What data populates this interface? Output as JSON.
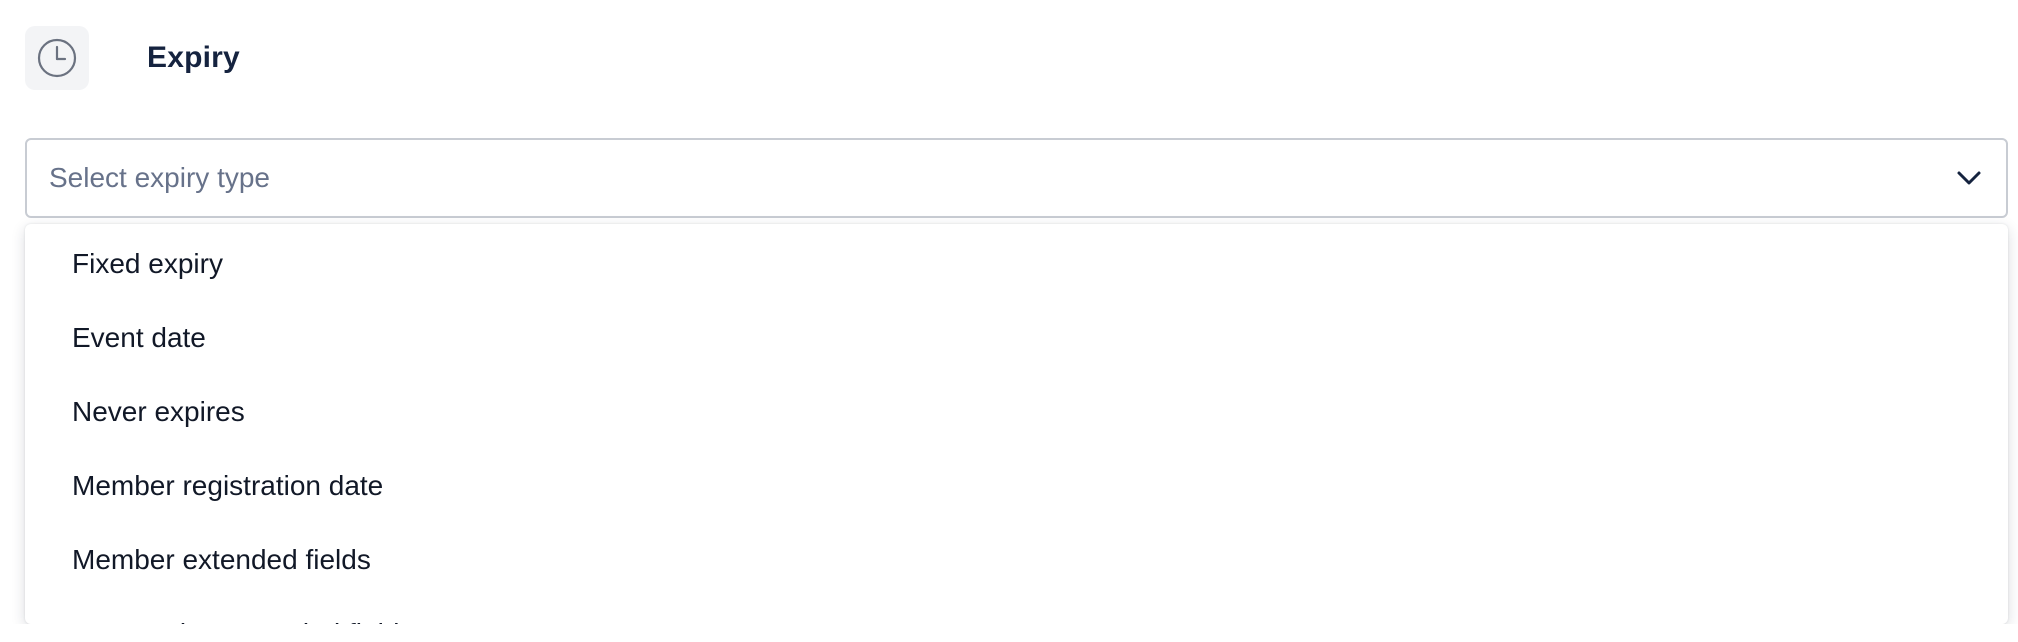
{
  "section": {
    "title": "Expiry",
    "icon": "clock-icon"
  },
  "select": {
    "placeholder": "Select expiry type",
    "icon": "chevron-down-icon"
  },
  "options": [
    "Fixed expiry",
    "Event date",
    "Never expires",
    "Member registration date",
    "Member extended fields",
    "Transaction extended fields"
  ],
  "colors": {
    "title": "#15233f",
    "placeholder": "#67728a",
    "border": "#c8ccd3",
    "icon_bg": "#f3f4f6",
    "option_text": "#111827"
  }
}
